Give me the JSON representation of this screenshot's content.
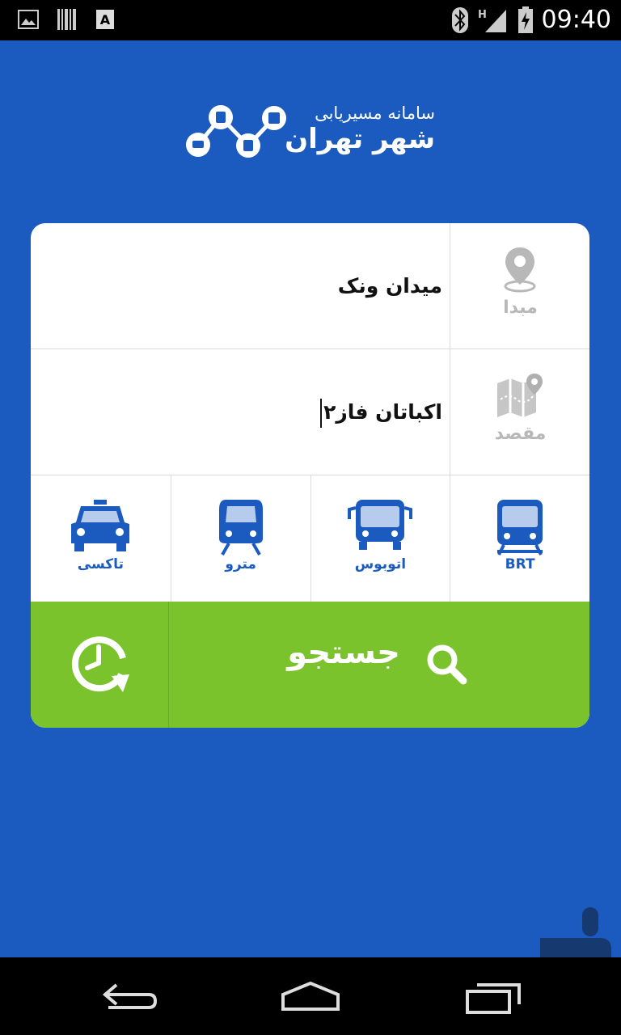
{
  "status_bar": {
    "time": "09:40",
    "left_icons": [
      "image-icon",
      "barcode-icon",
      "font-icon"
    ],
    "right_icons": [
      "bluetooth-icon",
      "signal-icon",
      "battery-charging-icon"
    ],
    "network_label": "H"
  },
  "header": {
    "logo_line1": "سامانه مسیریابی",
    "logo_line2": "شهر تهران"
  },
  "origin": {
    "label": "مبدا",
    "icon": "map-pin-icon",
    "value": "میدان ونک"
  },
  "destination": {
    "label": "مقصد",
    "icon": "map-icon",
    "value": "اکباتان فاز۲"
  },
  "modes": [
    {
      "key": "brt",
      "label": "BRT",
      "icon": "brt-bus-icon"
    },
    {
      "key": "bus",
      "label": "اتوبوس",
      "icon": "bus-icon"
    },
    {
      "key": "metro",
      "label": "مترو",
      "icon": "metro-icon"
    },
    {
      "key": "taxi",
      "label": "تاکسی",
      "icon": "taxi-icon"
    }
  ],
  "actions": {
    "search_label": "جستجو",
    "search_icon": "search-icon",
    "history_icon": "history-clock-icon"
  },
  "colors": {
    "primary": "#1b5bbf",
    "accent": "#7ac32c",
    "muted": "#b8b8b8"
  },
  "nav_bar": {
    "buttons": [
      "back-icon",
      "home-icon",
      "recents-icon"
    ]
  }
}
